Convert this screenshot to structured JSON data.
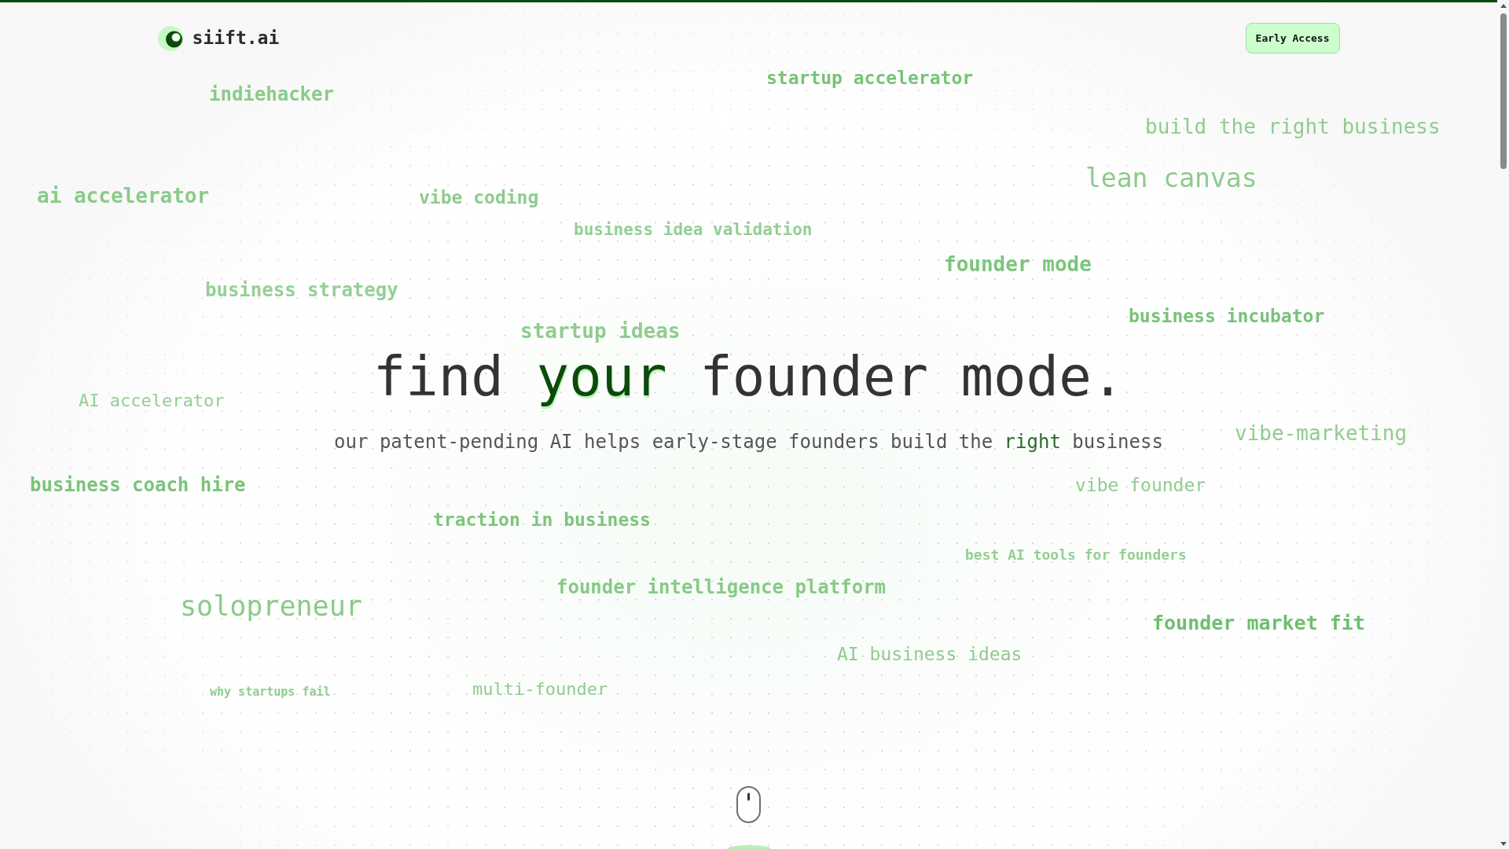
{
  "brand": {
    "name": "siift.ai"
  },
  "header": {
    "button": "Early Access"
  },
  "keywords": [
    "startup accelerator",
    "indiehacker",
    "build the right business",
    "lean canvas",
    "ai accelerator",
    "vibe coding",
    "business idea validation",
    "founder mode",
    "business strategy",
    "business incubator",
    "startup ideas",
    "AI accelerator",
    "vibe-marketing",
    "business coach hire",
    "vibe founder",
    "traction in business",
    "best AI tools for founders",
    "founder intelligence platform",
    "solopreneur",
    "founder market fit",
    "AI business ideas",
    "why startups fail",
    "multi-founder"
  ],
  "hero": {
    "title": {
      "before": "find",
      "highlight": "your",
      "after": "founder mode."
    },
    "subtitle": {
      "before": "our patent-pending AI helps early-stage founders build the",
      "highlight": "right",
      "after": "business"
    }
  }
}
